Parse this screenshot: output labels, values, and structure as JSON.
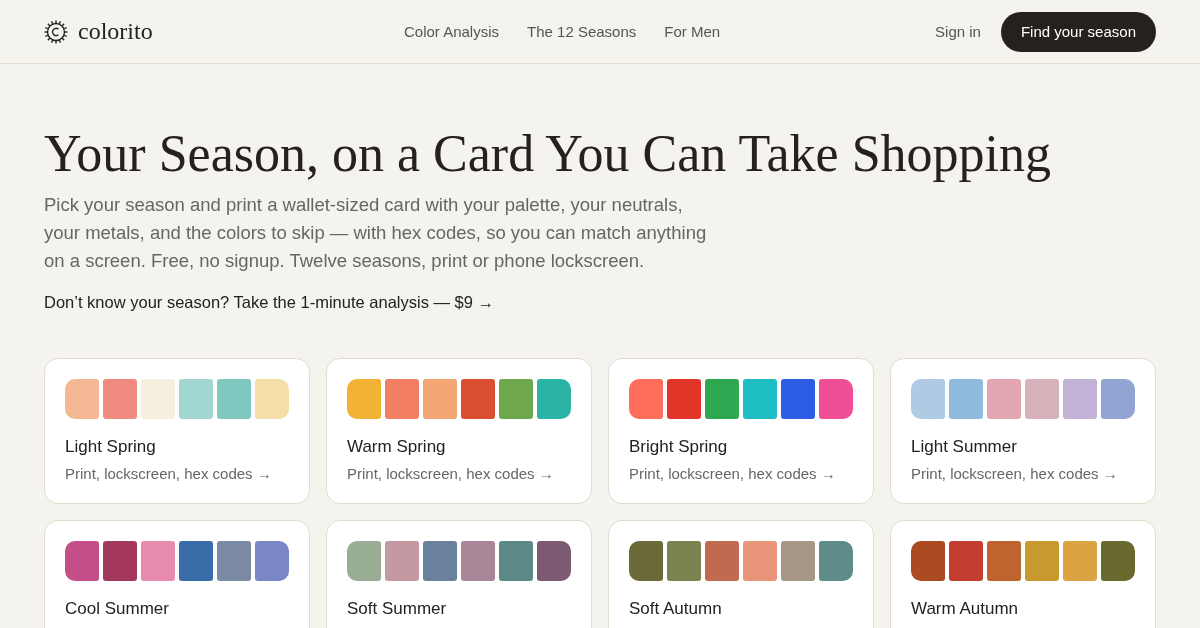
{
  "nav": {
    "logo": "colorito",
    "links": [
      "Color Analysis",
      "The 12 Seasons",
      "For Men"
    ],
    "sign_in": "Sign in",
    "cta": "Find your season"
  },
  "hero": {
    "title": "Your Season, on a Card You Can Take Shopping",
    "lead": "Pick your season and print a wallet-sized card with your palette, your neutrals, your metals, and the colors to skip — with hex codes, so you can match anything on a screen. Free, no signup. Twelve seasons, print or phone lockscreen.",
    "link": "Don’t know your season? Take the 1-minute analysis — $9 →"
  },
  "seasons": [
    {
      "name": "Light Spring",
      "subtitle": "Print, lockscreen, hex codes →",
      "swatches": [
        {
          "color": "#f4b894"
        },
        {
          "color": "#f08b80"
        },
        {
          "color": "#f6efe0"
        },
        {
          "color": "#a2d6d0"
        },
        {
          "color": "#80c8bf"
        },
        {
          "color": "#f4dfa8"
        }
      ]
    },
    {
      "name": "Warm Spring",
      "subtitle": "Print, lockscreen, hex codes →",
      "swatches": [
        {
          "color": "#f2b233"
        },
        {
          "color": "#f27e64"
        },
        {
          "color": "#f5a675"
        },
        {
          "color": "#d94f2f"
        },
        {
          "color": "#6fa74e"
        },
        {
          "color": "#2bb3a6"
        }
      ]
    },
    {
      "name": "Bright Spring",
      "subtitle": "Print, lockscreen, hex codes →",
      "swatches": [
        {
          "color": "#ff6d5c"
        },
        {
          "color": "#e1352a"
        },
        {
          "color": "#2fa650"
        },
        {
          "color": "#1fbec4"
        },
        {
          "color": "#2d5ce5"
        },
        {
          "color": "#f04f98"
        }
      ]
    },
    {
      "name": "Light Summer",
      "subtitle": "Print, lockscreen, hex codes →",
      "swatches": [
        {
          "color": "#afcbe3"
        },
        {
          "color": "#8fbade"
        },
        {
          "color": "#e3a7b2"
        },
        {
          "color": "#d8b2ba"
        },
        {
          "color": "#c2b2d5"
        },
        {
          "color": "#92a4d2"
        }
      ]
    },
    {
      "name": "Cool Summer",
      "swatches": [
        {
          "color": "#c44f88"
        },
        {
          "color": "#a4385c"
        },
        {
          "color": "#e68bad"
        },
        {
          "color": "#396da9"
        },
        {
          "color": "#7a8aa2"
        },
        {
          "color": "#7b86c5"
        }
      ]
    },
    {
      "name": "Soft Summer",
      "swatches": [
        {
          "color": "#9aae96"
        },
        {
          "color": "#c599a2"
        },
        {
          "color": "#6a809f"
        },
        {
          "color": "#a98698"
        },
        {
          "color": "#5c8987"
        },
        {
          "color": "#7b5a72"
        }
      ]
    },
    {
      "name": "Soft Autumn",
      "swatches": [
        {
          "color": "#6b6a38"
        },
        {
          "color": "#79834f"
        },
        {
          "color": "#c06a4f"
        },
        {
          "color": "#e8957a"
        },
        {
          "color": "#a69784"
        },
        {
          "color": "#5e8a87"
        }
      ]
    },
    {
      "name": "Warm Autumn",
      "swatches": [
        {
          "color": "#ac4b22"
        },
        {
          "color": "#c43e2f"
        },
        {
          "color": "#be642e"
        },
        {
          "color": "#c8992e"
        },
        {
          "color": "#dba342"
        },
        {
          "color": "#686a2d"
        }
      ]
    }
  ]
}
